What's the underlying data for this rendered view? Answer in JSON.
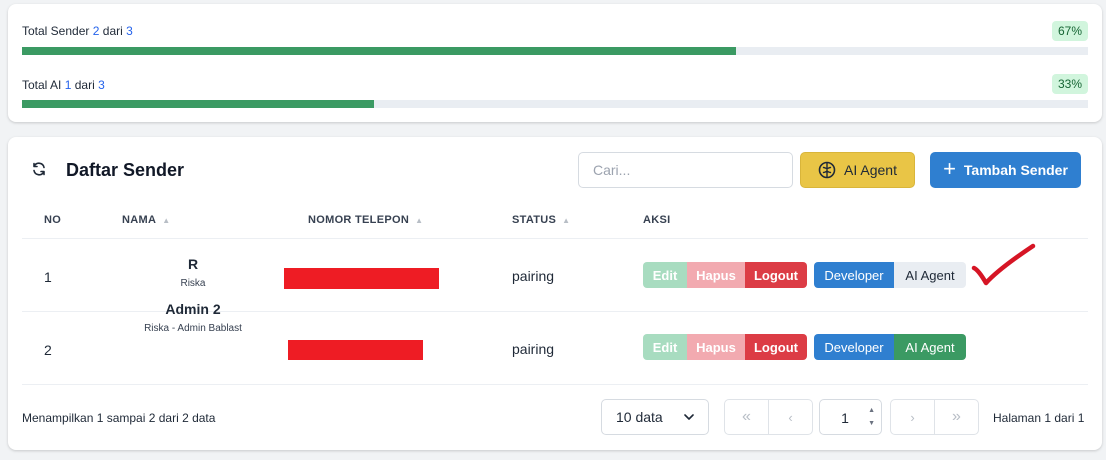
{
  "stats": [
    {
      "label": "Total Sender",
      "current": "2",
      "sep": "dari",
      "total": "3",
      "percent": "67%",
      "fill": 0.67
    },
    {
      "label": "Total AI",
      "current": "1",
      "sep": "dari",
      "total": "3",
      "percent": "33%",
      "fill": 0.33
    }
  ],
  "card": {
    "title": "Daftar Sender",
    "search_placeholder": "Cari...",
    "ai_agent_label": "AI Agent",
    "add_label": "Tambah Sender"
  },
  "table": {
    "headers": [
      "NO",
      "NAMA",
      "NOMOR TELEPON",
      "STATUS",
      "AKSI"
    ],
    "rows": [
      {
        "no": "1",
        "name": "R",
        "subtitle": "Riska",
        "status": "pairing",
        "ai_agent_active": false
      },
      {
        "no": "2",
        "name": "Admin 2",
        "subtitle": "Riska - Admin Bablast",
        "status": "pairing",
        "ai_agent_active": true
      }
    ],
    "actions": {
      "edit": "Edit",
      "hapus": "Hapus",
      "logout": "Logout",
      "developer": "Developer",
      "ai_agent": "AI Agent"
    }
  },
  "footer": {
    "showing": "Menampilkan 1 sampai 2 dari 2 data",
    "per_page": "10 data",
    "page_input": "1",
    "page_label": "Halaman 1 dari 1"
  },
  "colors": {
    "accent": "#2f7fd0",
    "success": "#3b9a63",
    "warning": "#e9c546",
    "danger": "#dc3c45",
    "annotation": "#d61525"
  }
}
